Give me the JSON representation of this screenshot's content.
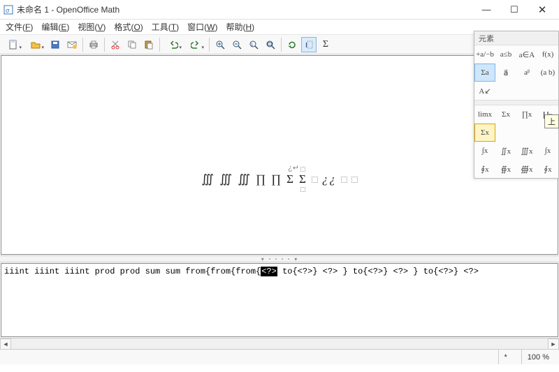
{
  "window": {
    "title": "未命名 1 - OpenOffice Math",
    "minimize": "—",
    "maximize": "☐",
    "close": "✕"
  },
  "menu": {
    "file": {
      "label": "文件",
      "key": "F"
    },
    "edit": {
      "label": "编辑",
      "key": "E"
    },
    "view": {
      "label": "视图",
      "key": "V"
    },
    "format": {
      "label": "格式",
      "key": "O"
    },
    "tools": {
      "label": "工具",
      "key": "T"
    },
    "window": {
      "label": "窗口",
      "key": "W"
    },
    "help": {
      "label": "帮助",
      "key": "H"
    }
  },
  "toolbar": {
    "new": "new",
    "open": "open",
    "save": "save",
    "mail": "mail",
    "print": "print",
    "cut": "cut",
    "copy": "copy",
    "paste": "paste",
    "undo": "undo",
    "redo": "redo",
    "zoomout": "zoom-out",
    "zoomin": "zoom-in",
    "zoom100": "zoom-100",
    "zoomfit": "zoom-fit",
    "refresh": "refresh",
    "cursor": "cursor",
    "sigma": "Σ"
  },
  "formula": {
    "marker": "¿↵",
    "glyphs": [
      "∭",
      "∭",
      "∭",
      "∏",
      "∏",
      "Σ",
      "Σ"
    ],
    "placeholders": 3
  },
  "editor": {
    "pre": "iiint iiint iiint prod prod sum sum from{from{from{",
    "sel": "<?>",
    "post": " to{<?>} <?> } to{<?>} <?> } to{<?>} <?>"
  },
  "palette": {
    "title": "元素",
    "cat": {
      "unary": "+a/−b",
      "rel": "a≤b",
      "set": "a∈A",
      "func": "f(x)",
      "sumop": "Σa",
      "vec": "a⃗",
      "attr": "aᵝ",
      "brack": "(a b)",
      "format": "A↙"
    },
    "ops": {
      "lim": "limx",
      "sum": "Σx",
      "prod": "∏x",
      "coprod": "∐x",
      "sumlim": "Σx",
      "tooltip": "上",
      "int": "∫x",
      "iint": "∬x",
      "iiint": "∭x",
      "intlim": "∫x",
      "oint": "∮x",
      "oiint": "∯x",
      "oiiint": "∰x",
      "ointlim": "∮x"
    }
  },
  "status": {
    "modified": "*",
    "zoom": "100 %"
  }
}
